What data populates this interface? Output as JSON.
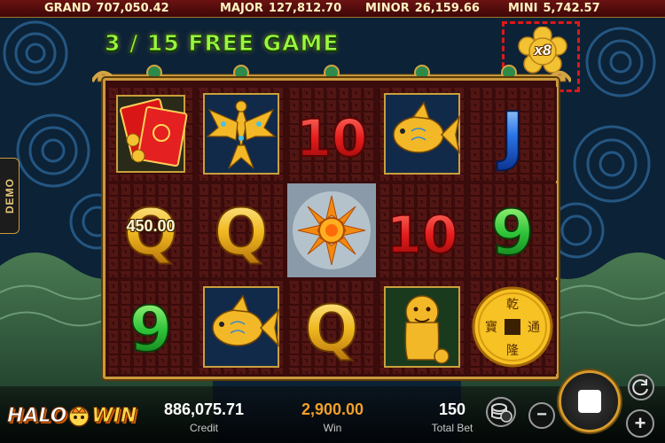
{
  "jackpots": [
    {
      "label": "GRAND",
      "value": "707,050.42"
    },
    {
      "label": "MAJOR",
      "value": "127,812.70"
    },
    {
      "label": "MINOR",
      "value": "26,159.66"
    },
    {
      "label": "MINI",
      "value": "5,742.57"
    }
  ],
  "free_game": {
    "text": "3 / 15 FREE GAME"
  },
  "multiplier": {
    "text": "x8"
  },
  "side_tab": {
    "label": "DEMO"
  },
  "reels": {
    "win_amount": "450.00",
    "symbols": [
      [
        "red-envelope",
        "q",
        "9"
      ],
      [
        "phoenix",
        "q",
        "fish"
      ],
      [
        "10",
        "sun-flower",
        "q"
      ],
      [
        "fish",
        "10",
        "foo-dog"
      ],
      [
        "j",
        "9",
        "gold-coin"
      ]
    ],
    "coin_chars": [
      "乾",
      "通",
      "隆",
      "寶"
    ],
    "highlighted": [
      "reel-1-row-2",
      "reel-2-row-2",
      "reel-3-row-2",
      "reel-3-row-3"
    ]
  },
  "bottom": {
    "logo_left": "HALO",
    "logo_right": "WIN",
    "credit_value": "886,075.71",
    "credit_label": "Credit",
    "win_value": "2,900.00",
    "win_label": "Win",
    "bet_value": "150",
    "bet_label": "Total Bet",
    "minus": "−",
    "plus": "+"
  },
  "colors": {
    "highlight": "#e0231d",
    "frame_gold": "#c99a3c",
    "free_game_green": "#9cf542",
    "win_orange": "#f2a028"
  }
}
